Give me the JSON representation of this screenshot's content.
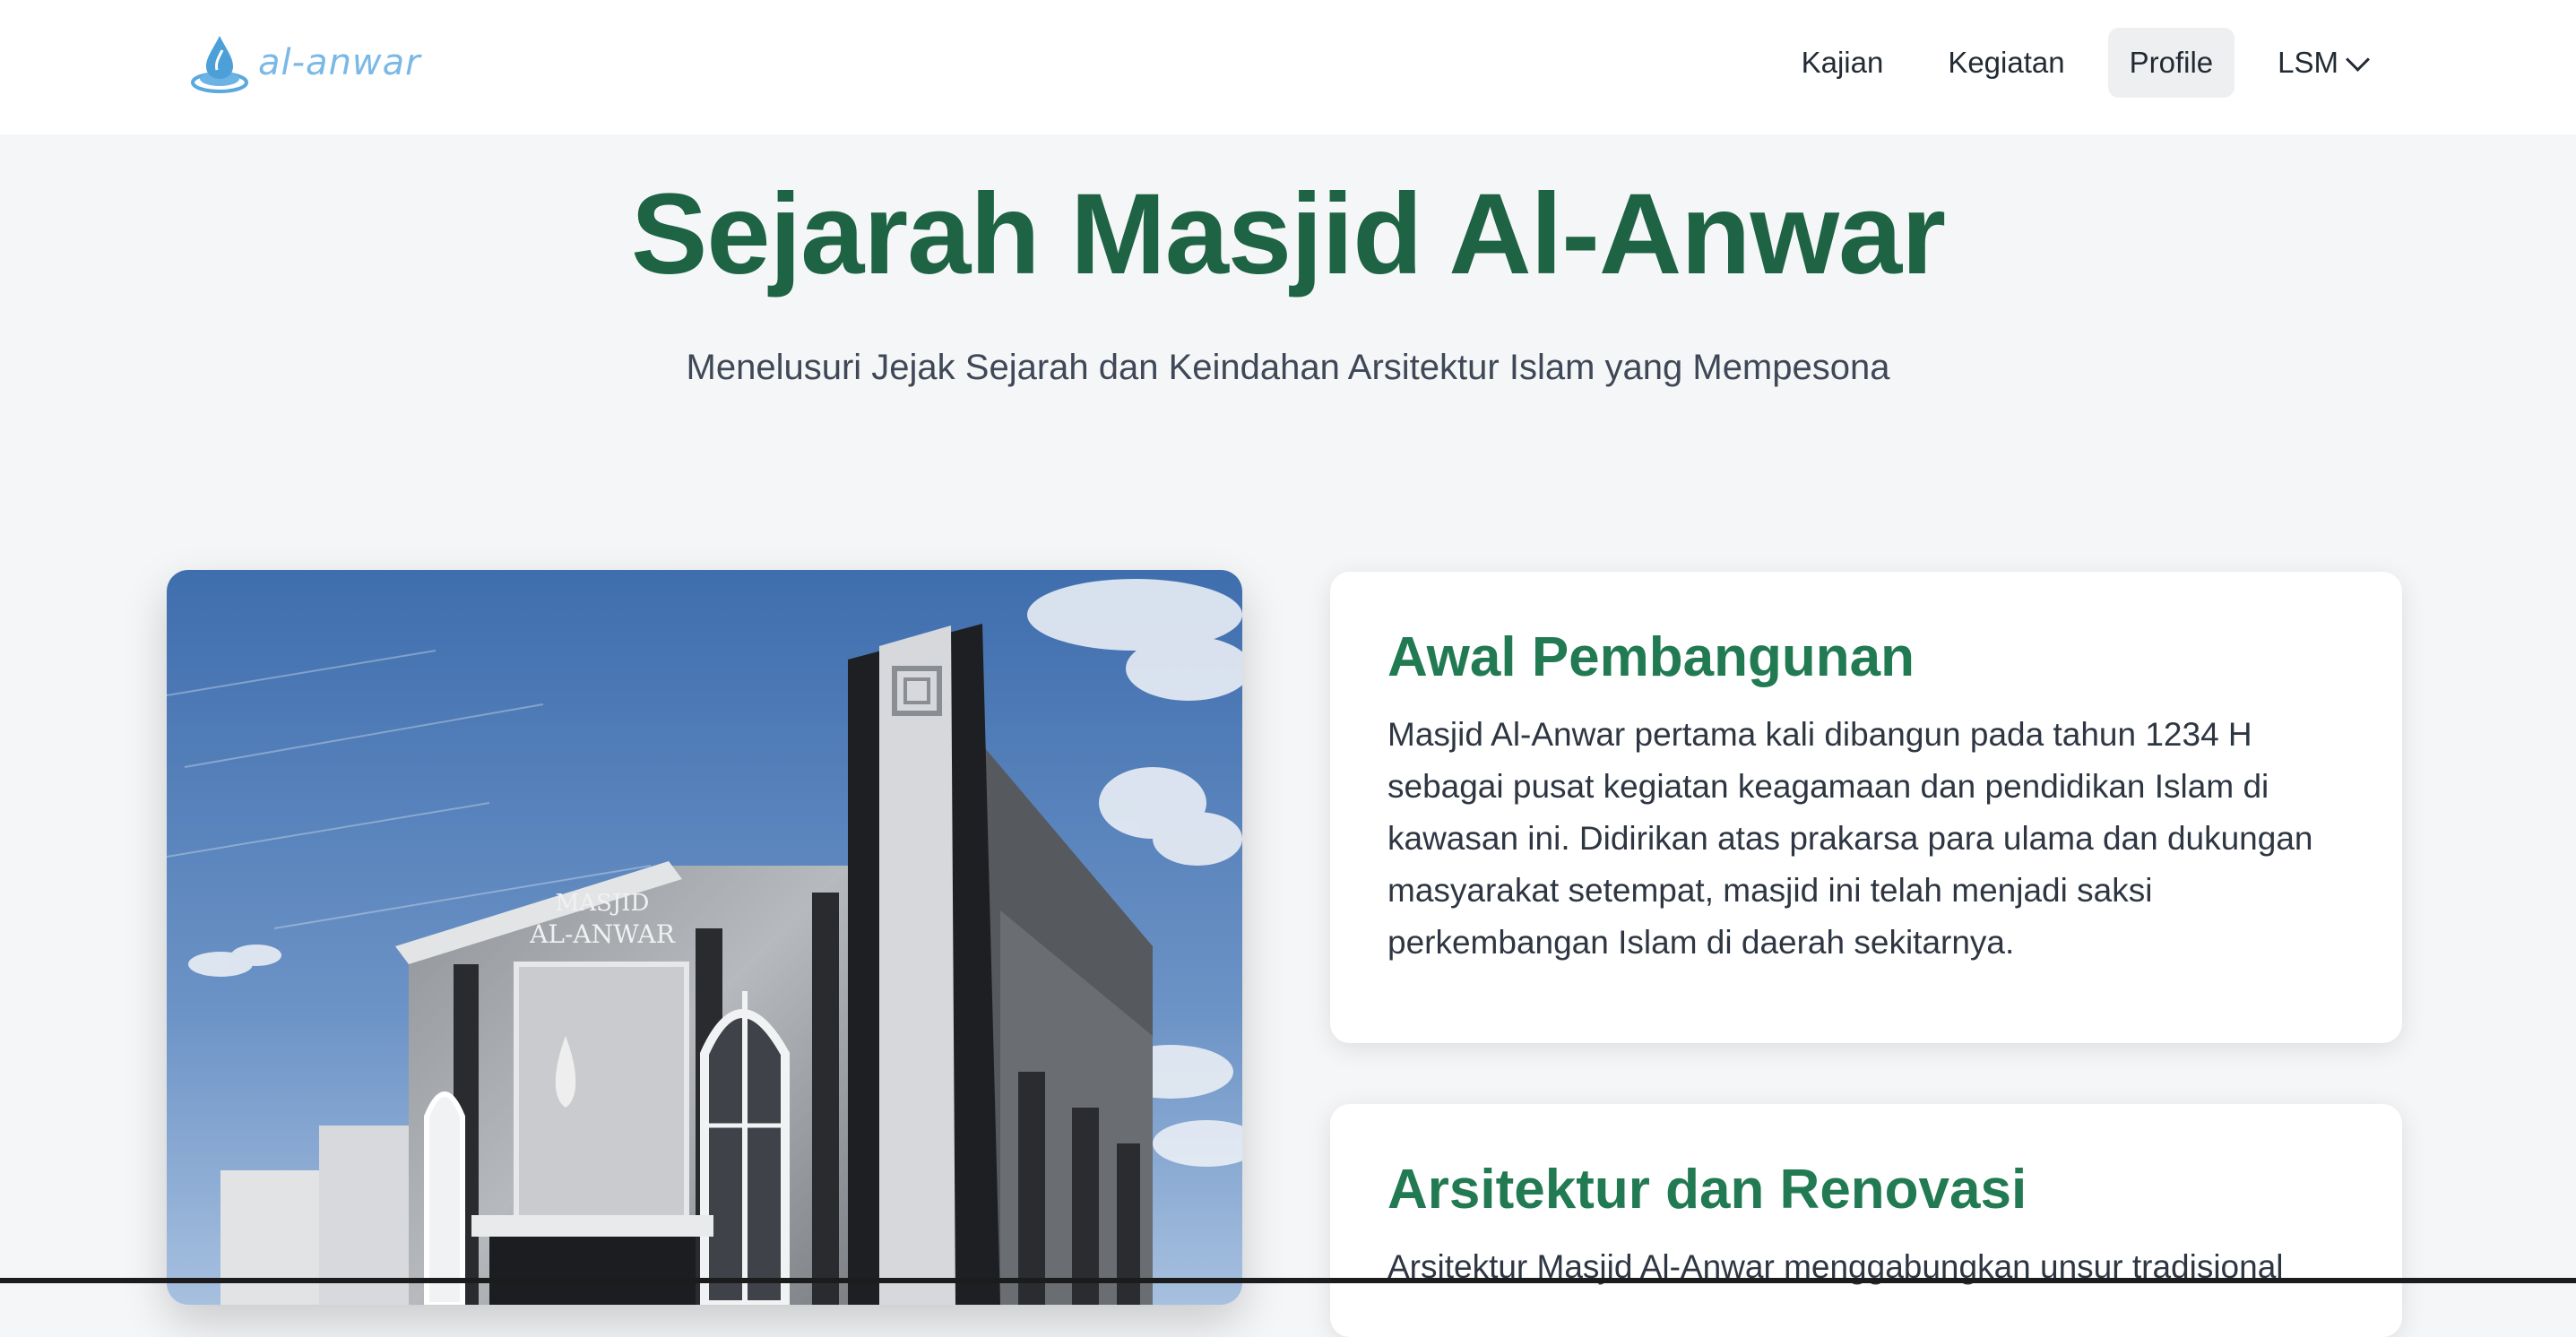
{
  "header": {
    "logo_text": "al-anwar",
    "nav": [
      {
        "label": "Kajian"
      },
      {
        "label": "Kegiatan"
      },
      {
        "label": "Profile",
        "active": true
      },
      {
        "label": "LSM",
        "has_dropdown": true
      }
    ]
  },
  "hero": {
    "title": "Sejarah Masjid Al-Anwar",
    "subtitle": "Menelusuri Jejak Sejarah dan Keindahan Arsitektur Islam yang Mempesona"
  },
  "photo": {
    "sign_line1": "MASJID",
    "sign_line2": "AL-ANWAR"
  },
  "sections": [
    {
      "title": "Awal Pembangunan",
      "body": "Masjid Al-Anwar pertama kali dibangun pada tahun 1234 H sebagai pusat kegiatan keagamaan dan pendidikan Islam di kawasan ini. Didirikan atas prakarsa para ulama dan dukungan masyarakat setempat, masjid ini telah menjadi saksi perkembangan Islam di daerah sekitarnya."
    },
    {
      "title": "Arsitektur dan Renovasi",
      "body": "Arsitektur Masjid Al-Anwar menggabungkan unsur tradisional"
    }
  ],
  "colors": {
    "brand_green": "#1e6444",
    "card_title_green": "#217a52",
    "logo_blue": "#7ab8e6",
    "page_bg": "#f5f6f8"
  }
}
